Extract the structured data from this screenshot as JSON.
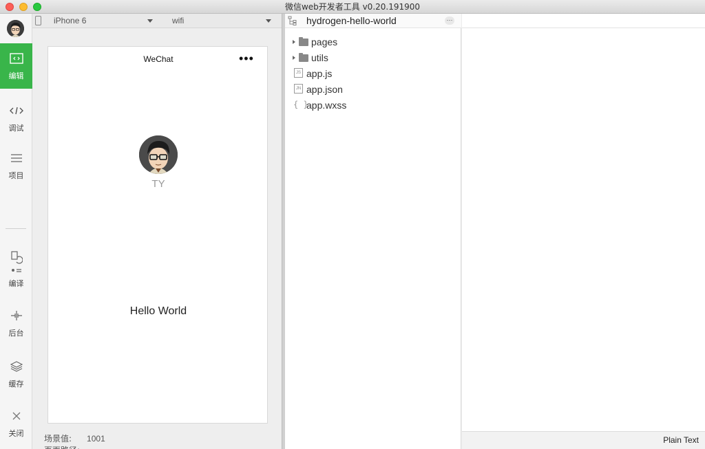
{
  "window": {
    "title": "微信web开发者工具 v0.20.191900"
  },
  "sidebar": {
    "items": [
      {
        "label": "编辑",
        "icon": "code-icon",
        "active": true
      },
      {
        "label": "调试",
        "icon": "debug-icon",
        "active": false
      },
      {
        "label": "项目",
        "icon": "menu-icon",
        "active": false
      },
      {
        "label": "编译",
        "icon": "compile-icon",
        "active": false
      },
      {
        "label": "后台",
        "icon": "background-icon",
        "active": false
      },
      {
        "label": "缓存",
        "icon": "layers-icon",
        "active": false
      },
      {
        "label": "关闭",
        "icon": "close-icon",
        "active": false
      }
    ]
  },
  "simulator": {
    "device": "iPhone 6",
    "network": "wifi",
    "nav_title": "WeChat",
    "nav_more": "•••",
    "nickname": "TY",
    "hello_text": "Hello World",
    "scene_label": "场景值:",
    "scene_value": "1001",
    "page_path_label": "页面路径:"
  },
  "project": {
    "name": "hydrogen-hello-world",
    "more_label": "···",
    "files": [
      {
        "name": "pages",
        "type": "folder"
      },
      {
        "name": "utils",
        "type": "folder"
      },
      {
        "name": "app.js",
        "type": "file",
        "badge": "JS"
      },
      {
        "name": "app.json",
        "type": "file",
        "badge": "JN"
      },
      {
        "name": "app.wxss",
        "type": "file",
        "badge": "{ }"
      }
    ]
  },
  "editor": {
    "language_mode": "Plain Text"
  },
  "colors": {
    "accent": "#39b54a",
    "close": "#fc5f57",
    "minimize": "#fdbc2e",
    "maximize": "#29c840"
  }
}
